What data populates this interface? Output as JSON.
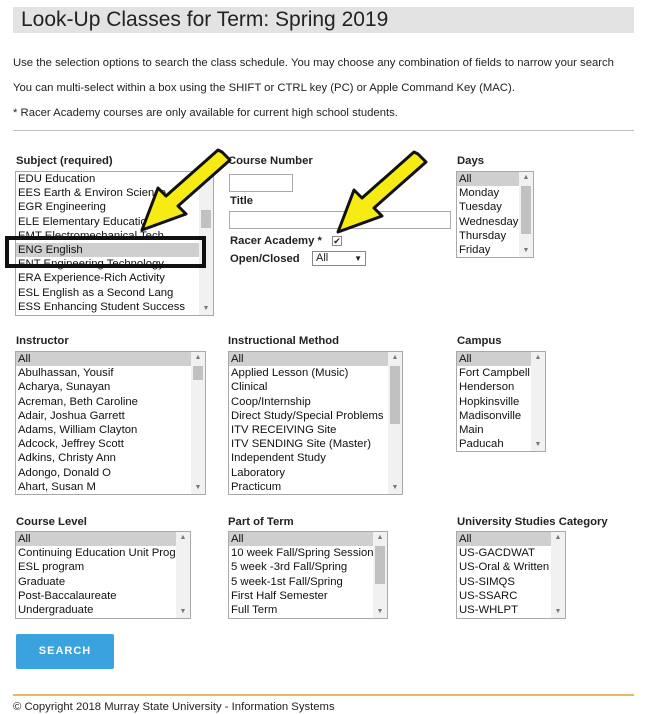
{
  "page": {
    "title": "Look-Up Classes for Term: Spring 2019",
    "instructions": [
      "Use the selection options to search the class schedule. You may choose any combination of fields to narrow your search",
      "You can multi-select within a box using the SHIFT or CTRL key (PC) or Apple Command Key (MAC).",
      "* Racer Academy courses are only available for current high school students."
    ]
  },
  "subject": {
    "label": "Subject (required)",
    "options": [
      "EDU Education",
      "EES Earth & Environ Science",
      "EGR Engineering",
      "ELE Elementary Education",
      "EMT Electromechanical Tech",
      "ENG English",
      "ENT Engineering Technology",
      "ERA Experience-Rich Activity",
      "ESL English as a Second Lang",
      "ESS Enhancing Student Success"
    ],
    "selected": "ENG English"
  },
  "course_number": {
    "label": "Course Number",
    "value": ""
  },
  "title_field": {
    "label": "Title",
    "value": ""
  },
  "racer_academy": {
    "label": "Racer Academy *",
    "checked": true
  },
  "open_closed": {
    "label": "Open/Closed",
    "value": "All"
  },
  "days": {
    "label": "Days",
    "options": [
      "All",
      "Monday",
      "Tuesday",
      "Wednesday",
      "Thursday",
      "Friday"
    ],
    "selected": "All"
  },
  "instructor": {
    "label": "Instructor",
    "options": [
      "All",
      "Abulhassan, Yousif",
      "Acharya, Sunayan",
      "Acreman, Beth Caroline",
      "Adair, Joshua Garrett",
      "Adams, William Clayton",
      "Adcock, Jeffrey Scott",
      "Adkins, Christy Ann",
      "Adongo, Donald O",
      "Ahart, Susan M"
    ],
    "selected": "All"
  },
  "instructional_method": {
    "label": "Instructional Method",
    "options": [
      "All",
      "Applied Lesson (Music)",
      "Clinical",
      "Coop/Internship",
      "Direct Study/Special Problems",
      "ITV RECEIVING Site",
      "ITV SENDING Site (Master)",
      "Independent Study",
      "Laboratory",
      "Practicum"
    ],
    "selected": "All"
  },
  "campus": {
    "label": "Campus",
    "options": [
      "All",
      "Fort Campbell",
      "Henderson",
      "Hopkinsville",
      "Madisonville",
      "Main",
      "Paducah"
    ],
    "selected": "All"
  },
  "course_level": {
    "label": "Course Level",
    "options": [
      "All",
      "Continuing Education Unit Prog",
      "ESL program",
      "Graduate",
      "Post-Baccalaureate",
      "Undergraduate"
    ],
    "selected": "All"
  },
  "part_of_term": {
    "label": "Part of Term",
    "options": [
      "All",
      "10 week Fall/Spring Session",
      "5 week -3rd Fall/Spring",
      "5 week-1st Fall/Spring",
      "First Half Semester",
      "Full Term"
    ],
    "selected": "All"
  },
  "university_studies": {
    "label": "University Studies Category",
    "options": [
      "All",
      "US-GACDWAT",
      "US-Oral & Written",
      "US-SIMQS",
      "US-SSARC",
      "US-WHLPT"
    ],
    "selected": "All"
  },
  "search_button": {
    "label": "SEARCH"
  },
  "footer": {
    "copyright": "© Copyright 2018 Murray State University - Information Systems"
  },
  "colors": {
    "accent": "#3aa3dd",
    "arrow": "#f6ec14",
    "footer_rule": "#e6b86a",
    "title_bg": "#e3e3e3"
  }
}
